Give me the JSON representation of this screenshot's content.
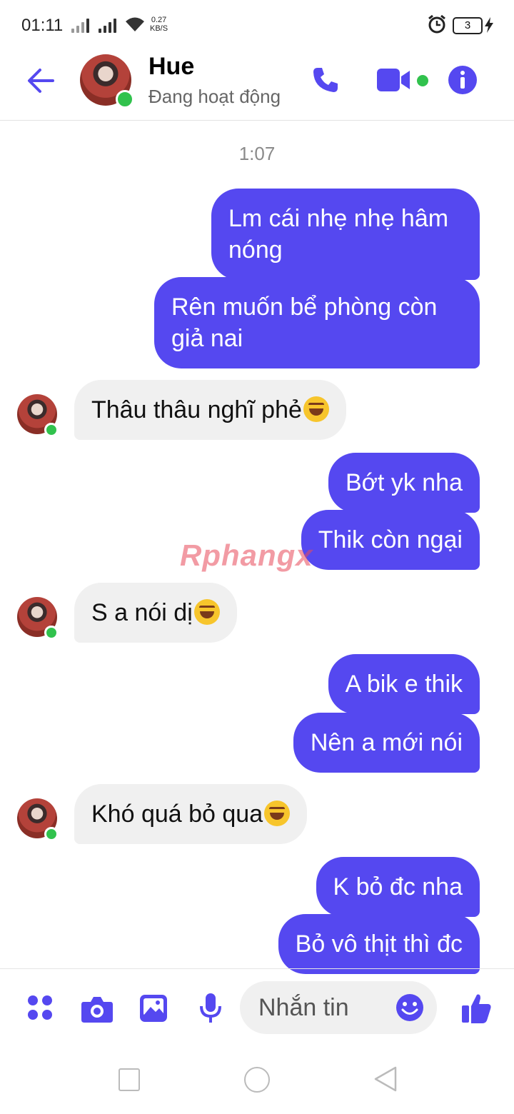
{
  "status_bar": {
    "time": "01:11",
    "net_speed_value": "0.27",
    "net_speed_unit": "KB/S",
    "battery": "3"
  },
  "header": {
    "contact_name": "Hue",
    "status": "Đang hoạt động"
  },
  "chat": {
    "timestamp": "1:07",
    "messages": [
      {
        "dir": "out",
        "text": "Lm cái nhẹ nhẹ hâm nóng"
      },
      {
        "dir": "out",
        "text": "Rên muốn bể phòng còn giả nai"
      },
      {
        "dir": "in",
        "text": "Thâu thâu nghĩ phẻ",
        "emoji": "tears-of-joy"
      },
      {
        "dir": "out",
        "text": "Bớt yk nha"
      },
      {
        "dir": "out",
        "text": "Thik còn ngại"
      },
      {
        "dir": "in",
        "text": "S a nói dị",
        "emoji": "rolling-laughing"
      },
      {
        "dir": "out",
        "text": "A bik e thik"
      },
      {
        "dir": "out",
        "text": "Nên a mới nói"
      },
      {
        "dir": "in",
        "text": "Khó quá bỏ qua",
        "emoji": "tears-of-joy"
      },
      {
        "dir": "out",
        "text": "K bỏ đc nha"
      },
      {
        "dir": "out",
        "text": "Bỏ vô thịt thì đc"
      }
    ],
    "watermark": "Rphangx"
  },
  "composer": {
    "placeholder": "Nhắn tin"
  },
  "colors": {
    "accent": "#5548f0",
    "online": "#31c24d",
    "incoming_bubble": "#f0f0f0"
  }
}
